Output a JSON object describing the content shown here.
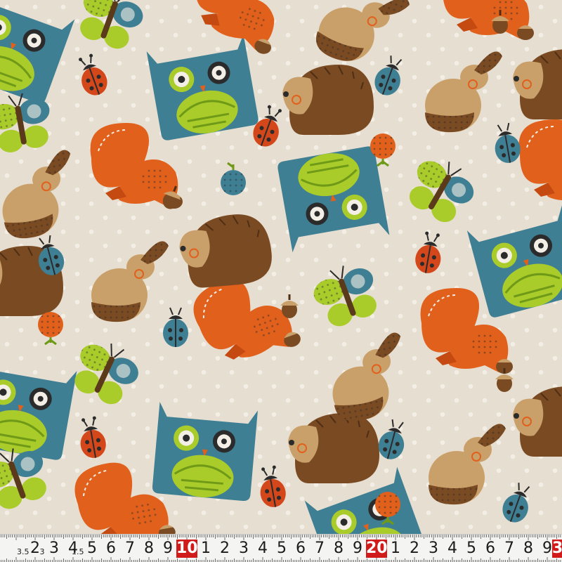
{
  "description_free": true,
  "fabric": {
    "background": "#e6ded0",
    "dot_color": "#f4efe6",
    "palette": {
      "orange": "#e0601c",
      "orange_dark": "#c44a12",
      "teal": "#3f7f93",
      "lime": "#a9cc2a",
      "brown": "#7a4a22",
      "tan": "#caa06a",
      "dark": "#2b2b2b",
      "red": "#d4471b"
    }
  },
  "ruler": {
    "labels": [
      "2",
      "3",
      "4",
      "5",
      "6",
      "7",
      "8",
      "9",
      "10",
      "1",
      "2",
      "3",
      "4",
      "5",
      "6",
      "7",
      "8",
      "9",
      "20",
      "1",
      "2",
      "3",
      "4",
      "5",
      "6",
      "7",
      "8",
      "9",
      "3"
    ],
    "major_labels": [
      "10",
      "20",
      "3"
    ],
    "small_labels": [
      "3.5",
      "3",
      "1.5"
    ],
    "ruler_color": "#f4f4f2",
    "major_color": "#d11a1a"
  }
}
